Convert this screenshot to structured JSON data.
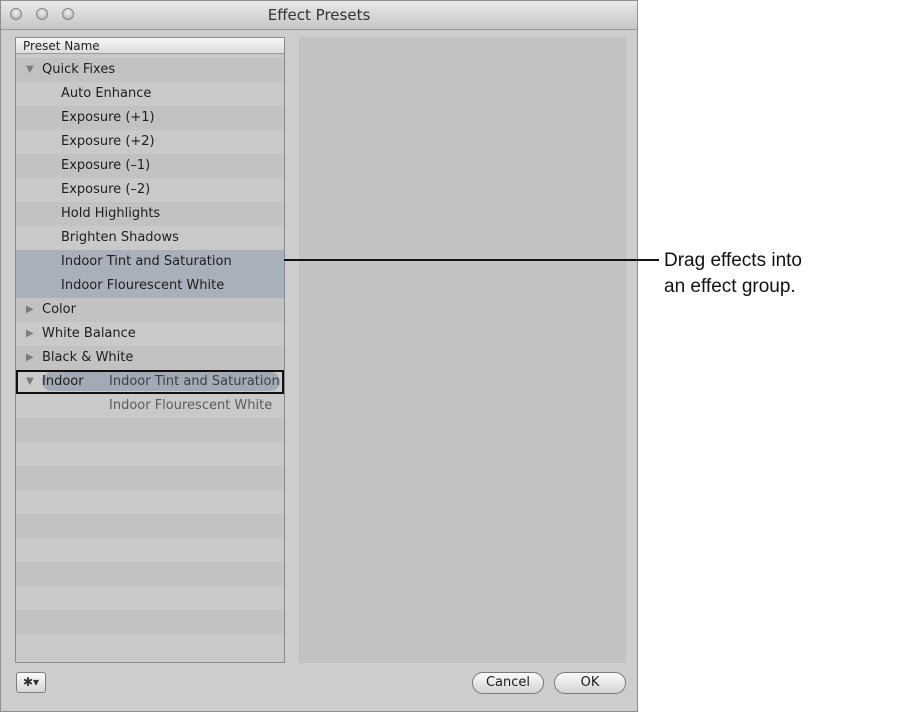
{
  "window": {
    "title": "Effect Presets"
  },
  "list": {
    "header": "Preset Name",
    "groups": [
      {
        "label": "Quick Fixes",
        "expanded": true,
        "children": [
          "Auto Enhance",
          "Exposure (+1)",
          "Exposure (+2)",
          "Exposure (–1)",
          "Exposure (–2)",
          "Hold Highlights",
          "Brighten Shadows",
          "Indoor Tint and Saturation",
          "Indoor Flourescent White"
        ]
      },
      {
        "label": "Color",
        "expanded": false
      },
      {
        "label": "White Balance",
        "expanded": false
      },
      {
        "label": "Black & White",
        "expanded": false
      },
      {
        "label": "Indoor",
        "expanded": true
      }
    ],
    "drag": {
      "items": [
        "Indoor Tint and Saturation",
        "Indoor Flourescent White"
      ]
    }
  },
  "buttons": {
    "cancel": "Cancel",
    "ok": "OK",
    "gear": "✱▾"
  },
  "callout": {
    "line1": "Drag effects into",
    "line2": "an effect group."
  },
  "colors": {
    "selection": "#a9b0bb",
    "window": "#cdcdcd"
  }
}
